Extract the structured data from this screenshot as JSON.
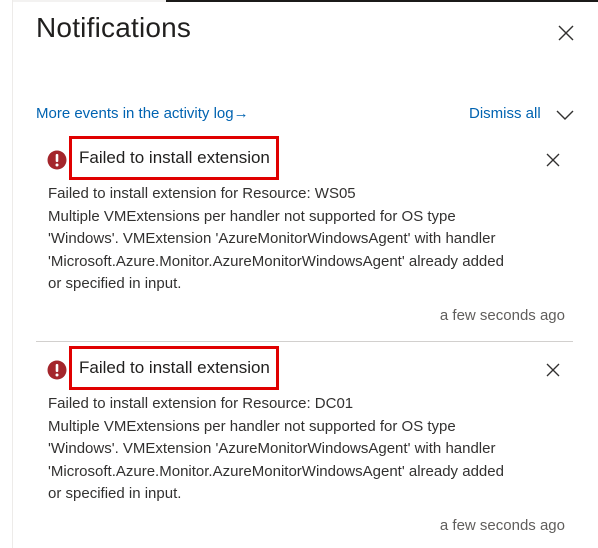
{
  "panel": {
    "title": "Notifications"
  },
  "toolbar": {
    "activity_link": "More events in the activity log",
    "activity_arrow": "→",
    "dismiss_all": "Dismiss all"
  },
  "notifications": [
    {
      "title": "Failed to install extension",
      "status_icon": "error-icon",
      "lines": [
        "Failed to install extension for Resource: WS05",
        "Multiple VMExtensions per handler not supported for OS type",
        "'Windows'. VMExtension 'AzureMonitorWindowsAgent' with handler",
        "'Microsoft.Azure.Monitor.AzureMonitorWindowsAgent' already added",
        "or specified in input."
      ],
      "time": "a few seconds ago"
    },
    {
      "title": "Failed to install extension",
      "status_icon": "error-icon",
      "lines": [
        "Failed to install extension for Resource: DC01",
        "Multiple VMExtensions per handler not supported for OS type",
        "'Windows'. VMExtension 'AzureMonitorWindowsAgent' with handler",
        "'Microsoft.Azure.Monitor.AzureMonitorWindowsAgent' already added",
        "or specified in input."
      ],
      "time": "a few seconds ago"
    }
  ],
  "colors": {
    "link": "#0063b1",
    "error": "#a4262c",
    "highlight_box": "#e00000",
    "text": "#323130",
    "muted": "#605e5c"
  }
}
